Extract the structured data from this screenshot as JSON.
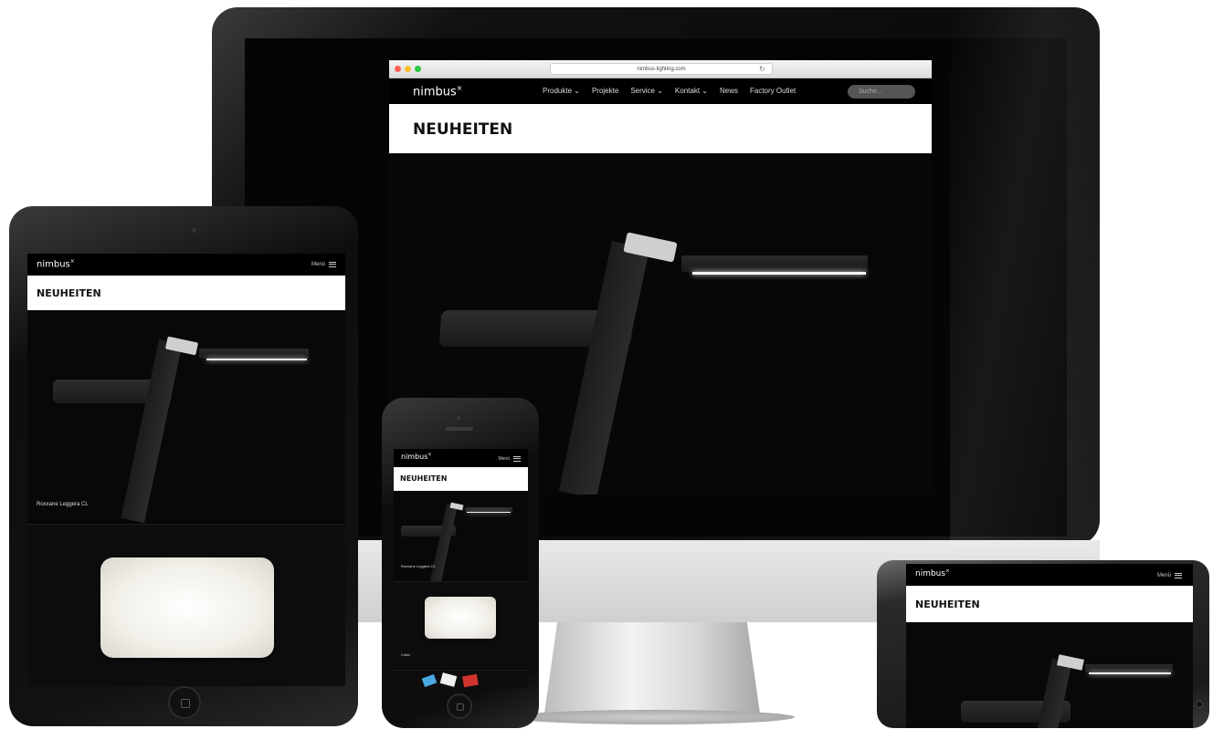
{
  "desktop": {
    "url": "nimbus-lighting.com",
    "logo": "nimbus",
    "logo_mark": "×",
    "nav_items": [
      "Produkte  ⌄",
      "Projekte",
      "Service  ⌄",
      "Kontakt  ⌄",
      "News",
      "Factory Outlet"
    ],
    "search_placeholder": "Suche...",
    "page_title": "NEUHEITEN"
  },
  "tablet": {
    "logo": "nimbus",
    "logo_mark": "×",
    "menu_label": "Menü",
    "page_title": "NEUHEITEN",
    "caption_1": "Roxxane Leggera CL"
  },
  "phone": {
    "logo": "nimbus",
    "logo_mark": "×",
    "menu_label": "Menü",
    "page_title": "NEUHEITEN",
    "caption_1": "Roxxane Leggera CL",
    "caption_2": "Cubic"
  },
  "landscape_phone": {
    "logo": "nimbus",
    "logo_mark": "×",
    "menu_label": "Menü",
    "page_title": "NEUHEITEN"
  },
  "icons": {
    "window_controls": [
      "close-dot",
      "minimize-dot",
      "zoom-dot"
    ],
    "reload": "reload-icon",
    "menu": "hamburger-icon",
    "home": "home-button-icon"
  },
  "colors": {
    "traffic_red": "#ff5f57",
    "traffic_yellow": "#febc2e",
    "traffic_green": "#28c840",
    "nav_bg": "#000000",
    "hero_bg": "#ffffff"
  }
}
